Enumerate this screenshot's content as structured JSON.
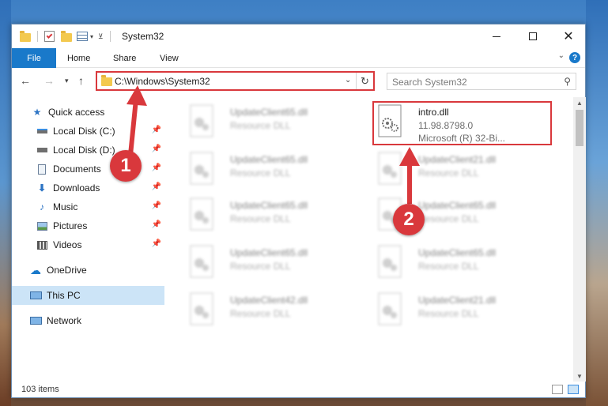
{
  "window": {
    "title": "System32"
  },
  "ribbon": {
    "tabs": [
      "File",
      "Home",
      "Share",
      "View"
    ],
    "help": "?"
  },
  "address": {
    "path": "C:\\Windows\\System32",
    "search_placeholder": "Search System32"
  },
  "sidebar": {
    "items": [
      {
        "label": "Quick access",
        "icon": "star-icon"
      },
      {
        "label": "Local Disk (C:)",
        "icon": "drive-icon",
        "pinned": true
      },
      {
        "label": "Local Disk (D:)",
        "icon": "drive-icon",
        "pinned": true
      },
      {
        "label": "Documents",
        "icon": "documents-icon",
        "pinned": true
      },
      {
        "label": "Downloads",
        "icon": "download-icon",
        "pinned": true
      },
      {
        "label": "Music",
        "icon": "music-icon",
        "pinned": true
      },
      {
        "label": "Pictures",
        "icon": "pictures-icon",
        "pinned": true
      },
      {
        "label": "Videos",
        "icon": "videos-icon",
        "pinned": true
      },
      {
        "label": "OneDrive",
        "icon": "cloud-icon"
      },
      {
        "label": "This PC",
        "icon": "computer-icon",
        "selected": true
      },
      {
        "label": "Network",
        "icon": "network-icon"
      }
    ]
  },
  "files": {
    "highlighted": {
      "name": "intro.dll",
      "version": "11.98.8798.0",
      "description": "Microsoft (R) 32-Bi..."
    },
    "left_column": [
      {
        "name": "UpdateClient65.dll",
        "type": "Resource DLL"
      },
      {
        "name": "UpdateClient65.dll",
        "type": "Resource DLL"
      },
      {
        "name": "UpdateClient65.dll",
        "type": "Resource DLL"
      },
      {
        "name": "UpdateClient65.dll",
        "type": "Resource DLL"
      },
      {
        "name": "UpdateClient42.dll",
        "type": "Resource DLL"
      }
    ],
    "right_column": [
      {
        "name": "UpdateClient21.dll",
        "type": "Resource DLL"
      },
      {
        "name": "UpdateClient65.dll",
        "type": "Resource DLL"
      },
      {
        "name": "UpdateClient65.dll",
        "type": "Resource DLL"
      },
      {
        "name": "UpdateClient21.dll",
        "type": "Resource DLL"
      }
    ]
  },
  "status": {
    "items_count": "103 items"
  },
  "annotations": {
    "step1": "1",
    "step2": "2"
  },
  "colors": {
    "accent": "#1979ca",
    "highlight": "#d9383c",
    "selected_bg": "#cce4f7"
  }
}
